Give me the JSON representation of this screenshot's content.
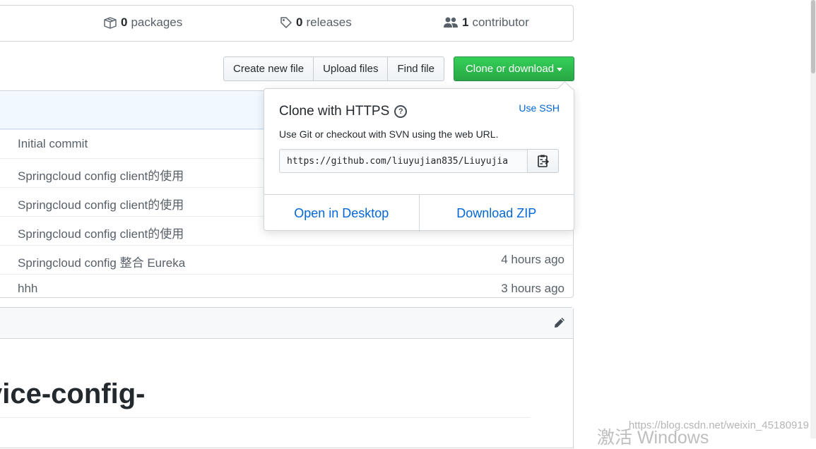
{
  "stats": {
    "packages_count": "0",
    "packages_label": "packages",
    "releases_count": "0",
    "releases_label": "releases",
    "contributors_count": "1",
    "contributors_label": "contributor"
  },
  "file_actions": {
    "create_new_file": "Create new file",
    "upload_files": "Upload files",
    "find_file": "Find file",
    "clone_or_download": "Clone or download"
  },
  "commits": [
    {
      "message": "Initial commit",
      "age": ""
    },
    {
      "message": "Springcloud config client的使用",
      "age": ""
    },
    {
      "message": "Springcloud config client的使用",
      "age": ""
    },
    {
      "message": "Springcloud config client的使用",
      "age": ""
    },
    {
      "message": "Springcloud config 整合 Eureka",
      "age": "4 hours ago"
    },
    {
      "message": "hhh",
      "age": "3 hours ago"
    }
  ],
  "readme": {
    "title_fragment": "vice-config-"
  },
  "clone_popup": {
    "title": "Clone with HTTPS",
    "use_ssh": "Use SSH",
    "description": "Use Git or checkout with SVN using the web URL.",
    "url": "https://github.com/liuyujian835/Liuyujia",
    "open_in_desktop": "Open in Desktop",
    "download_zip": "Download ZIP"
  },
  "watermarks": {
    "csdn": "https://blog.csdn.net/weixin_45180919",
    "windows": "激活 Windows"
  },
  "colors": {
    "primary_green": "#28a745",
    "link_blue": "#0366d6",
    "header_blue_bg": "#f1f8ff"
  }
}
